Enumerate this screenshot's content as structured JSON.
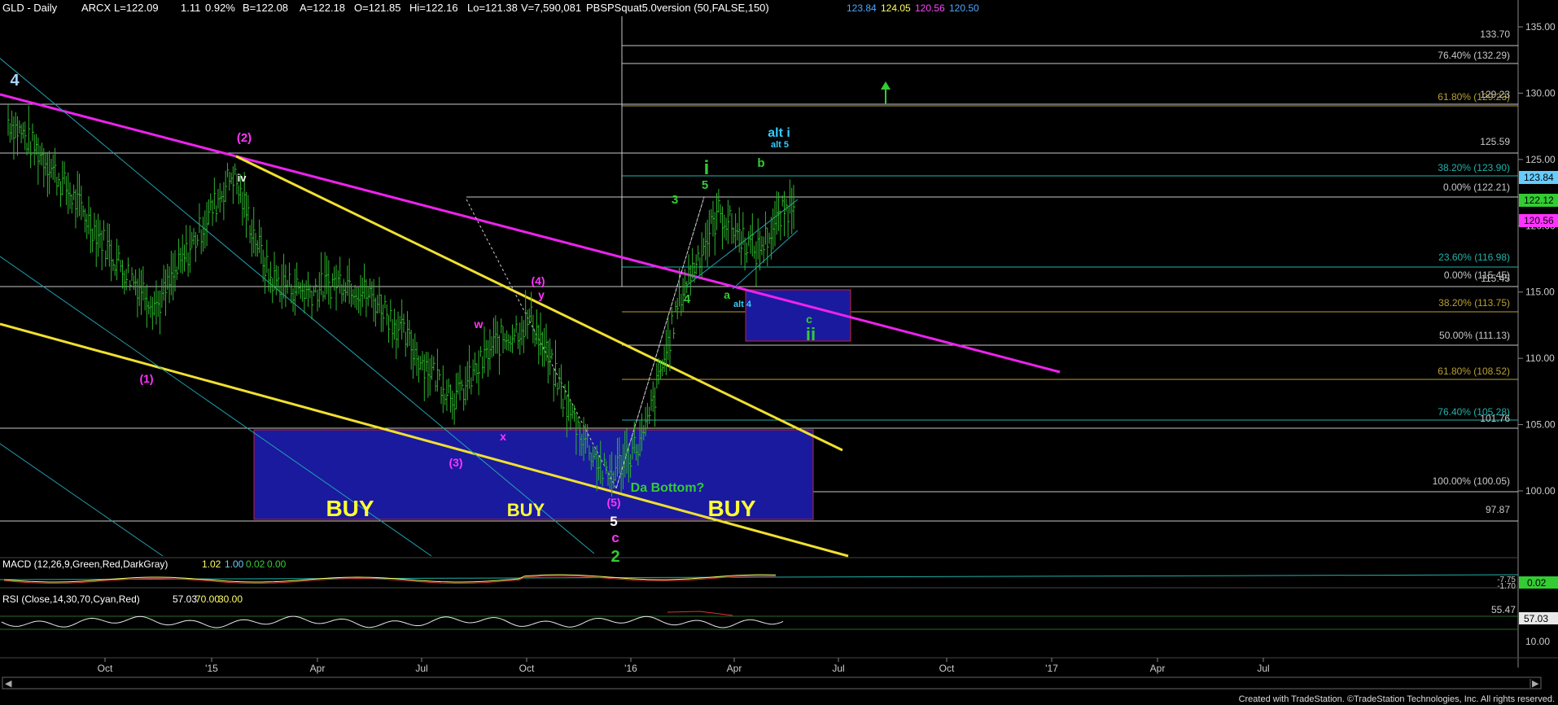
{
  "header": {
    "symbol": "GLD - Daily",
    "exchange": "ARCX",
    "last": "L=122.09",
    "change": "1.11",
    "change_pct": "0.92%",
    "bid": "B=122.08",
    "ask": "A=122.18",
    "open": "O=121.85",
    "high": "Hi=122.16",
    "low": "Lo=121.38",
    "volume": "V=7,590,081",
    "indicator": "PBSPSquat5.0version (50,FALSE,150)",
    "ind_vals": [
      "123.84",
      "124.05",
      "120.56",
      "120.50"
    ],
    "ind_colors": [
      "#4da6ff",
      "#ffff66",
      "#ff44ff",
      "#4da6ff"
    ]
  },
  "axis": {
    "price_ticks": [
      "135.00",
      "130.00",
      "125.00",
      "120.00",
      "115.00",
      "110.00",
      "105.00",
      "100.00"
    ],
    "price_tags": [
      {
        "text": "123.84",
        "bg": "#66ccff",
        "color": "#000"
      },
      {
        "text": "122.12",
        "bg": "#33cc33",
        "color": "#000"
      },
      {
        "text": "120.56",
        "bg": "#ff33ff",
        "color": "#000"
      }
    ],
    "macd_tag": "0.02",
    "macd_scale": [
      "-7.75",
      "-1.70"
    ],
    "rsi_ticks": [
      "55.47",
      "10.00"
    ],
    "rsi_tag": "57.03",
    "time_ticks": [
      "Oct",
      "'15",
      "Apr",
      "Jul",
      "Oct",
      "'16",
      "Apr",
      "Jul",
      "Oct",
      "'17",
      "Apr",
      "Jul"
    ]
  },
  "fib_labels": [
    {
      "text": "133.70",
      "color": "#c8c8c8"
    },
    {
      "text": "76.40% (132.29)",
      "color": "#c8c8c8"
    },
    {
      "text": "61.80% (129.23)",
      "color": "#b8a030"
    },
    {
      "text": "129.23",
      "color": "#c8c8c8"
    },
    {
      "text": "125.59",
      "color": "#c8c8c8"
    },
    {
      "text": "38.20% (123.90)",
      "color": "#20b2aa"
    },
    {
      "text": "0.00% (122.21)",
      "color": "#c8c8c8"
    },
    {
      "text": "23.60% (116.98)",
      "color": "#20b2aa"
    },
    {
      "text": "0.00% (115.45)",
      "color": "#c8c8c8"
    },
    {
      "text": "115.45",
      "color": "#c8c8c8"
    },
    {
      "text": "38.20% (113.75)",
      "color": "#b8a030"
    },
    {
      "text": "50.00% (111.13)",
      "color": "#c8c8c8"
    },
    {
      "text": "61.80% (108.52)",
      "color": "#b8a030"
    },
    {
      "text": "76.40% (105.28)",
      "color": "#20b2aa"
    },
    {
      "text": "101.76",
      "color": "#c8c8c8"
    },
    {
      "text": "100.00% (100.05)",
      "color": "#c8c8c8"
    },
    {
      "text": "97.87",
      "color": "#c8c8c8"
    }
  ],
  "wave_labels": [
    {
      "text": "4",
      "color": "#aad4ff"
    },
    {
      "text": "(2)",
      "color": "#ff33ff"
    },
    {
      "text": "iv",
      "color": "#ffffff"
    },
    {
      "text": "(1)",
      "color": "#ff33ff"
    },
    {
      "text": "(3)",
      "color": "#ff33ff"
    },
    {
      "text": "w",
      "color": "#ff33ff"
    },
    {
      "text": "x",
      "color": "#ff33ff"
    },
    {
      "text": "(4)",
      "color": "#ff33ff"
    },
    {
      "text": "y",
      "color": "#ff33ff"
    },
    {
      "text": "(5)",
      "color": "#ff33ff"
    },
    {
      "text": "5",
      "color": "#ffffff"
    },
    {
      "text": "c",
      "color": "#ff33ff"
    },
    {
      "text": "2",
      "color": "#33cc33"
    },
    {
      "text": "Da Bottom?",
      "color": "#33cc33"
    },
    {
      "text": "3",
      "color": "#33cc33"
    },
    {
      "text": "i",
      "color": "#33cc33"
    },
    {
      "text": "5",
      "color": "#33cc33"
    },
    {
      "text": "4",
      "color": "#33cc33"
    },
    {
      "text": "a",
      "color": "#33cc33"
    },
    {
      "text": "alt 4",
      "color": "#33ccff"
    },
    {
      "text": "b",
      "color": "#33cc33"
    },
    {
      "text": "alt i",
      "color": "#33ccff"
    },
    {
      "text": "alt 5",
      "color": "#33ccff"
    },
    {
      "text": "c",
      "color": "#33cc33"
    },
    {
      "text": "ii",
      "color": "#33cc33"
    },
    {
      "text": "BUY",
      "color": "#ffff33"
    },
    {
      "text": "BUY",
      "color": "#ffff33"
    },
    {
      "text": "BUY",
      "color": "#ffff33"
    }
  ],
  "macd_header": {
    "label": "MACD (12,26,9,Green,Red,DarkGray)",
    "vals": [
      "1.02",
      "1.00",
      "0.02",
      "0.00"
    ],
    "colors": [
      "#ffff66",
      "#66ccff",
      "#33cc33",
      "#33cc33"
    ]
  },
  "rsi_header": {
    "label": "RSI (Close,14,30,70,Cyan,Red)",
    "vals": [
      "57.03",
      "70.00",
      "30.00"
    ],
    "colors": [
      "#ffffff",
      "#ffff66",
      "#ffff66"
    ]
  },
  "footer": "Created with TradeStation. ©TradeStation Technologies, Inc. All rights reserved.",
  "chart_data": {
    "type": "line",
    "xlabel": "",
    "ylabel": "",
    "ylim": [
      96,
      136
    ],
    "x": [
      "2014-08",
      "2014-09",
      "2014-10",
      "2014-11",
      "2014-12",
      "2015-01",
      "2015-02",
      "2015-03",
      "2015-04",
      "2015-05",
      "2015-06",
      "2015-07",
      "2015-08",
      "2015-09",
      "2015-10",
      "2015-11",
      "2015-12",
      "2016-01",
      "2016-02",
      "2016-03",
      "2016-04",
      "2016-05"
    ],
    "series": [
      {
        "values": [
          128,
          125,
          121,
          117,
          114,
          119,
          124,
          116,
          115,
          116,
          114,
          110,
          107,
          111,
          113,
          106,
          101,
          104,
          115,
          121,
          118,
          122
        ]
      }
    ],
    "grid": false
  }
}
